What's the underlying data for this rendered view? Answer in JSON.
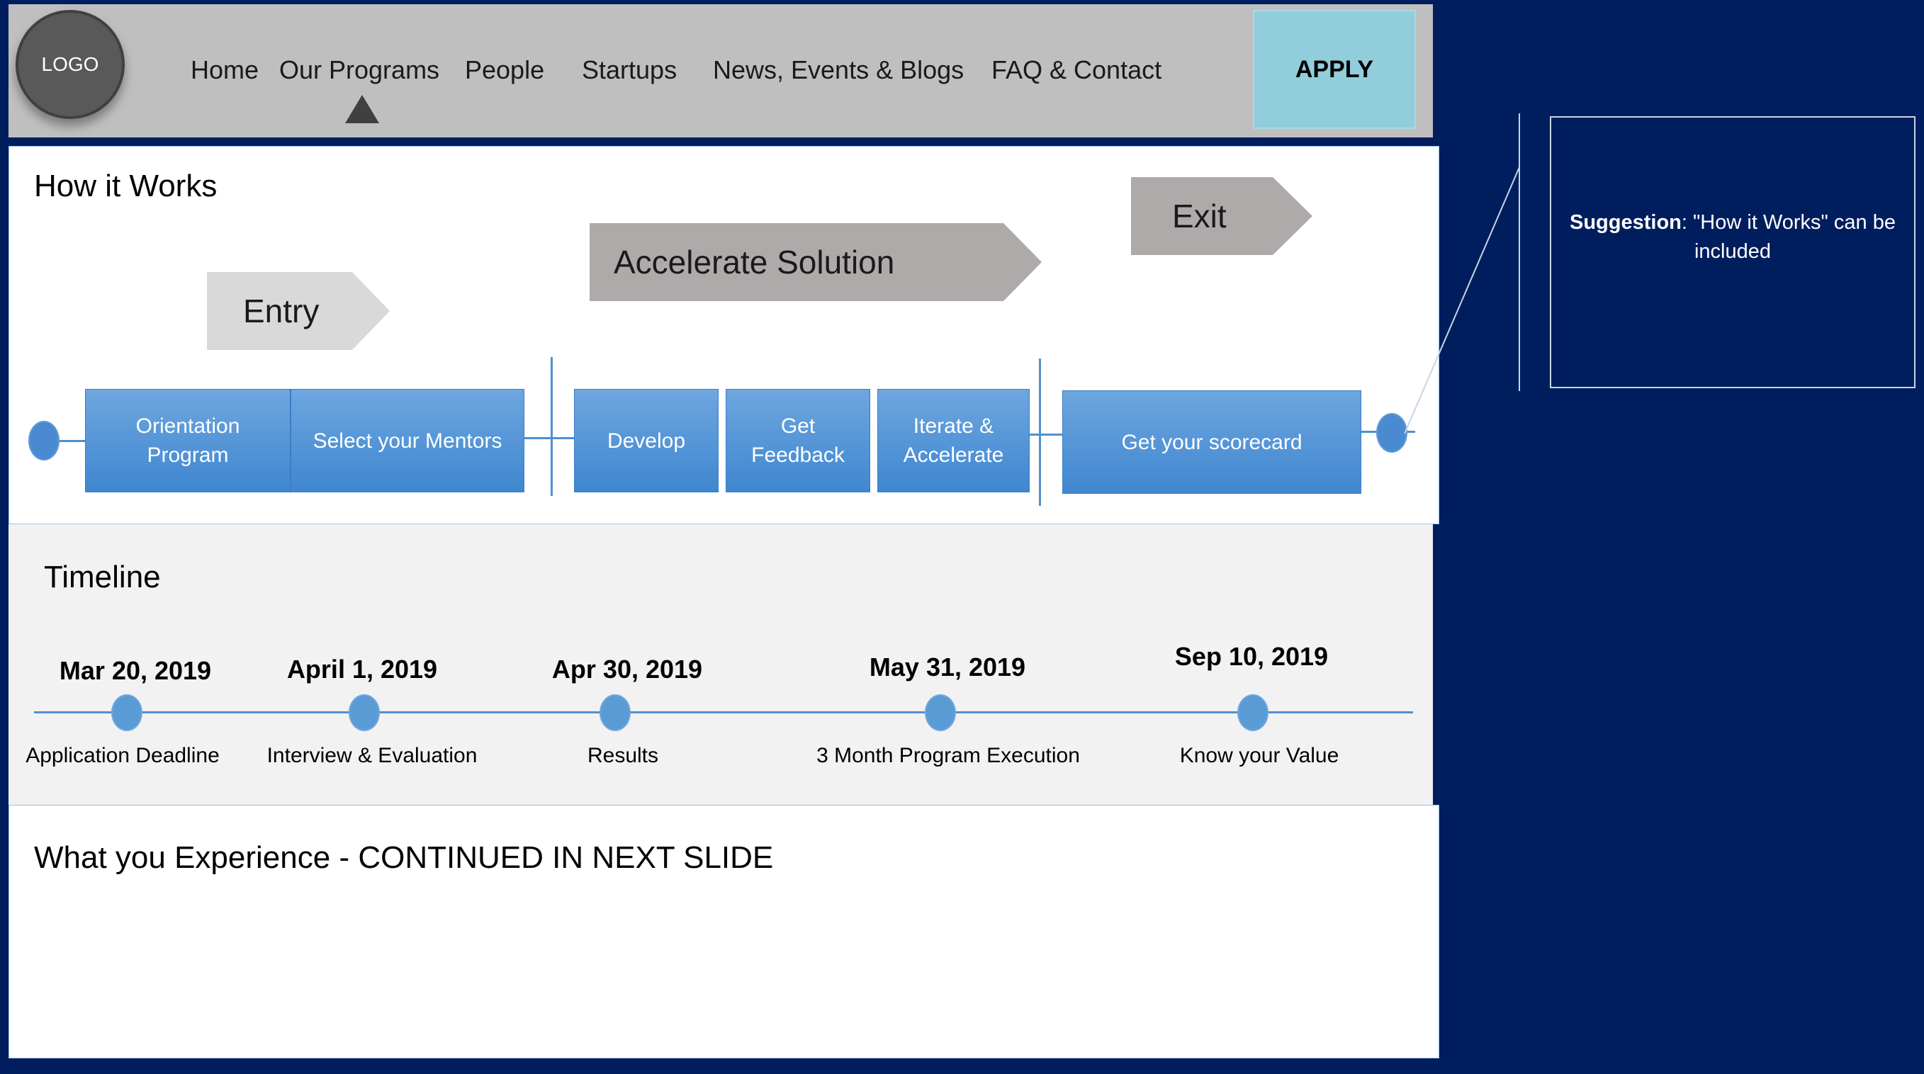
{
  "header": {
    "logo": "LOGO",
    "nav": [
      "Home",
      "Our Programs",
      "People",
      "Startups",
      "News, Events & Blogs",
      "FAQ & Contact"
    ],
    "apply_label": "APPLY"
  },
  "how_it_works": {
    "title": "How it Works",
    "phases": {
      "entry": "Entry",
      "accelerate": "Accelerate Solution",
      "exit": "Exit"
    },
    "steps": {
      "orientation_line1": "Orientation",
      "orientation_line2": "Program",
      "mentors": "Select your Mentors",
      "develop": "Develop",
      "feedback_line1": "Get",
      "feedback_line2": "Feedback",
      "iterate_line1": "Iterate &",
      "iterate_line2": "Accelerate",
      "scorecard": "Get your scorecard"
    }
  },
  "timeline": {
    "title": "Timeline",
    "milestones": [
      {
        "date": "Mar 20, 2019",
        "label": "Application Deadline"
      },
      {
        "date": "April 1, 2019",
        "label": "Interview & Evaluation"
      },
      {
        "date": "Apr 30, 2019",
        "label": "Results"
      },
      {
        "date": "May 31, 2019",
        "label": "3 Month Program Execution"
      },
      {
        "date": "Sep 10, 2019",
        "label": "Know your Value"
      }
    ]
  },
  "experience": {
    "title": "What you Experience  - CONTINUED IN NEXT SLIDE"
  },
  "suggestion": {
    "bold": "Suggestion",
    "text": ": \"How it Works\"  can be included"
  },
  "colors": {
    "background": "#001e5e",
    "header": "#bfbfbf",
    "apply": "#92cddc",
    "step_blue": "#4a8ad1",
    "phase_light": "#d9d9d9",
    "phase_dark": "#aeaaaa"
  }
}
